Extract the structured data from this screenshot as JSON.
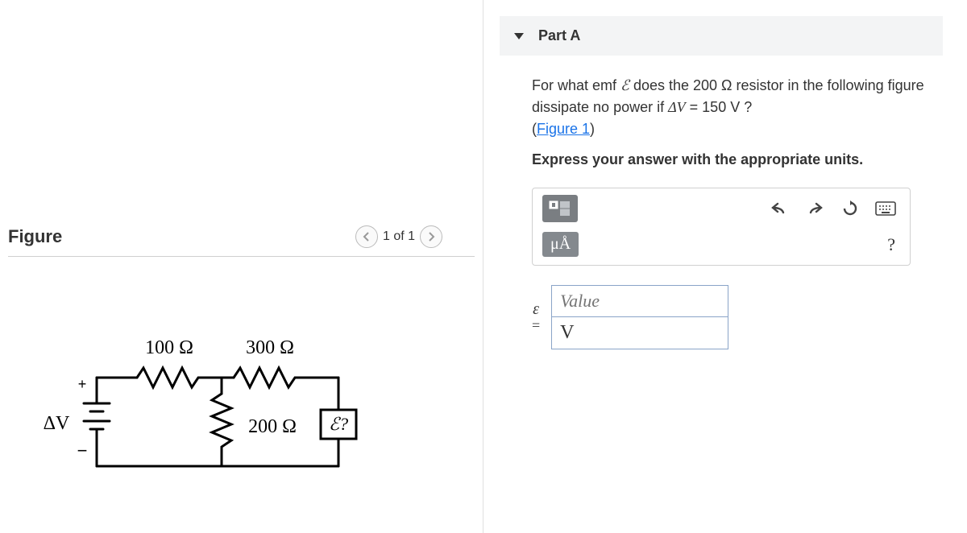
{
  "figure": {
    "title": "Figure",
    "nav": "1 of 1",
    "r1": "100 Ω",
    "r2": "300 Ω",
    "r3": "200 Ω",
    "dv": "ΔV",
    "emf": "ℰ?"
  },
  "part": {
    "title": "Part A",
    "question_prefix": "For what emf ",
    "emf_sym": "ℰ",
    "question_mid1": " does the 200 ",
    "ohm_sym": "Ω",
    "question_mid2": " resistor in the following figure dissipate no power if ",
    "dv_sym": "ΔV",
    "question_eq": " = 150  V ?",
    "figure_link": "Figure 1",
    "instruction": "Express your answer with the appropriate units."
  },
  "toolbar": {
    "units_label": "μÅ",
    "help": "?"
  },
  "answer": {
    "lhs": "ε",
    "equals": "=",
    "value_placeholder": "Value",
    "unit_value": "V"
  }
}
